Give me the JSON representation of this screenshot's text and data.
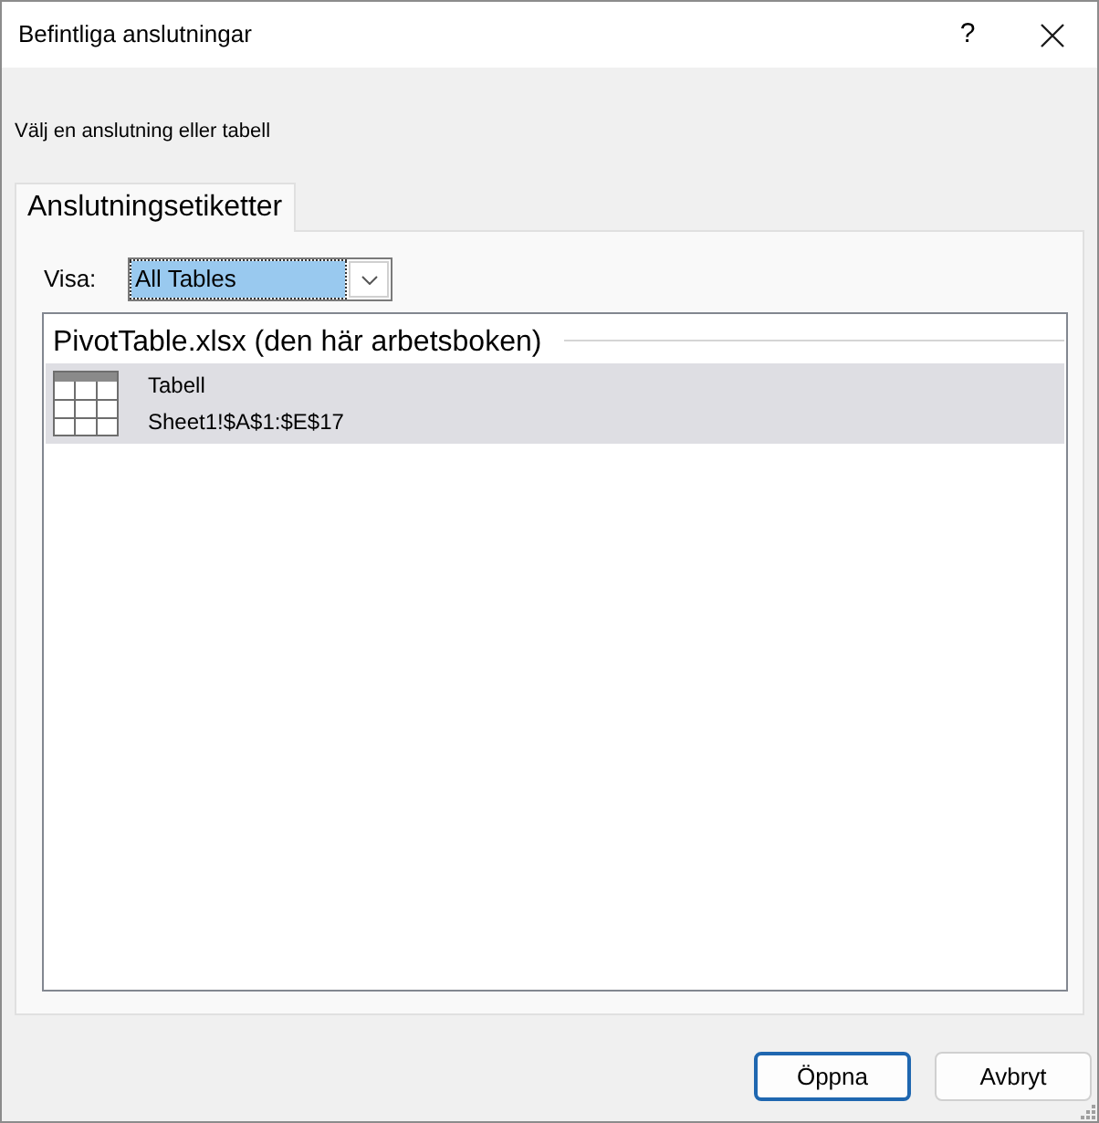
{
  "window": {
    "title": "Befintliga anslutningar",
    "help_button": "?"
  },
  "instruction": "Välj en anslutning eller tabell",
  "tabs": [
    {
      "label": "Anslutningsetiketter",
      "selected": true
    }
  ],
  "show_filter": {
    "label": "Visa:",
    "value": "All Tables",
    "focused": true
  },
  "list": {
    "groups": [
      {
        "heading": "PivotTable.xlsx (den här arbetsboken)",
        "items": [
          {
            "kind": "table",
            "name": "Tabell",
            "range": "Sheet1!$A$1:$E$17",
            "selected": true
          }
        ]
      }
    ]
  },
  "buttons": [
    {
      "label": "Öppna",
      "default": true
    },
    {
      "label": "Avbryt",
      "default": false
    }
  ]
}
